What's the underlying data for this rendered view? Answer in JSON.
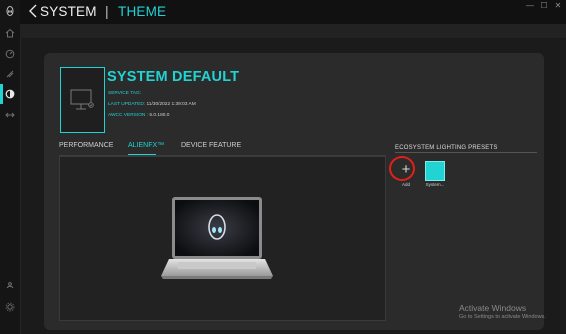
{
  "header": {
    "title": "SYSTEM",
    "separator": "|",
    "section": "THEME"
  },
  "window_controls": {
    "minimize": "—",
    "maximize": "☐",
    "close": "✕"
  },
  "sidebar": {
    "items": [
      {
        "icon": "alienware-logo-icon"
      },
      {
        "icon": "home-icon"
      },
      {
        "icon": "performance-icon"
      },
      {
        "icon": "library-icon"
      },
      {
        "icon": "theme-icon",
        "active": true
      },
      {
        "icon": "macros-icon"
      },
      {
        "icon": "help-icon"
      },
      {
        "icon": "settings-icon"
      }
    ]
  },
  "theme": {
    "name": "SYSTEM DEFAULT",
    "service_tag_label": "SERVICE TAG:",
    "service_tag_value": "",
    "last_updated_label": "LAST UPDATED:",
    "last_updated_value": "11/30/2022 1:39:03 AM",
    "awcc_version_label": "AWCC VERSION :",
    "awcc_version_value": "6.0.180.0"
  },
  "tabs": [
    {
      "label": "PERFORMANCE"
    },
    {
      "label": "ALIENFX™",
      "active": true
    },
    {
      "label": "DEVICE FEATURE"
    }
  ],
  "presets": {
    "title": "ECOSYSTEM LIGHTING PRESETS",
    "add_label": "Add",
    "items": [
      {
        "label": "System...",
        "color": "#22d3d3"
      }
    ]
  },
  "watermark": {
    "title": "Activate Windows",
    "subtitle": "Go to Settings to activate Windows."
  },
  "colors": {
    "accent": "#22d3d3",
    "highlight_circle": "#e0201b",
    "background": "#1b1b1b",
    "panel": "#2b2b2b"
  }
}
